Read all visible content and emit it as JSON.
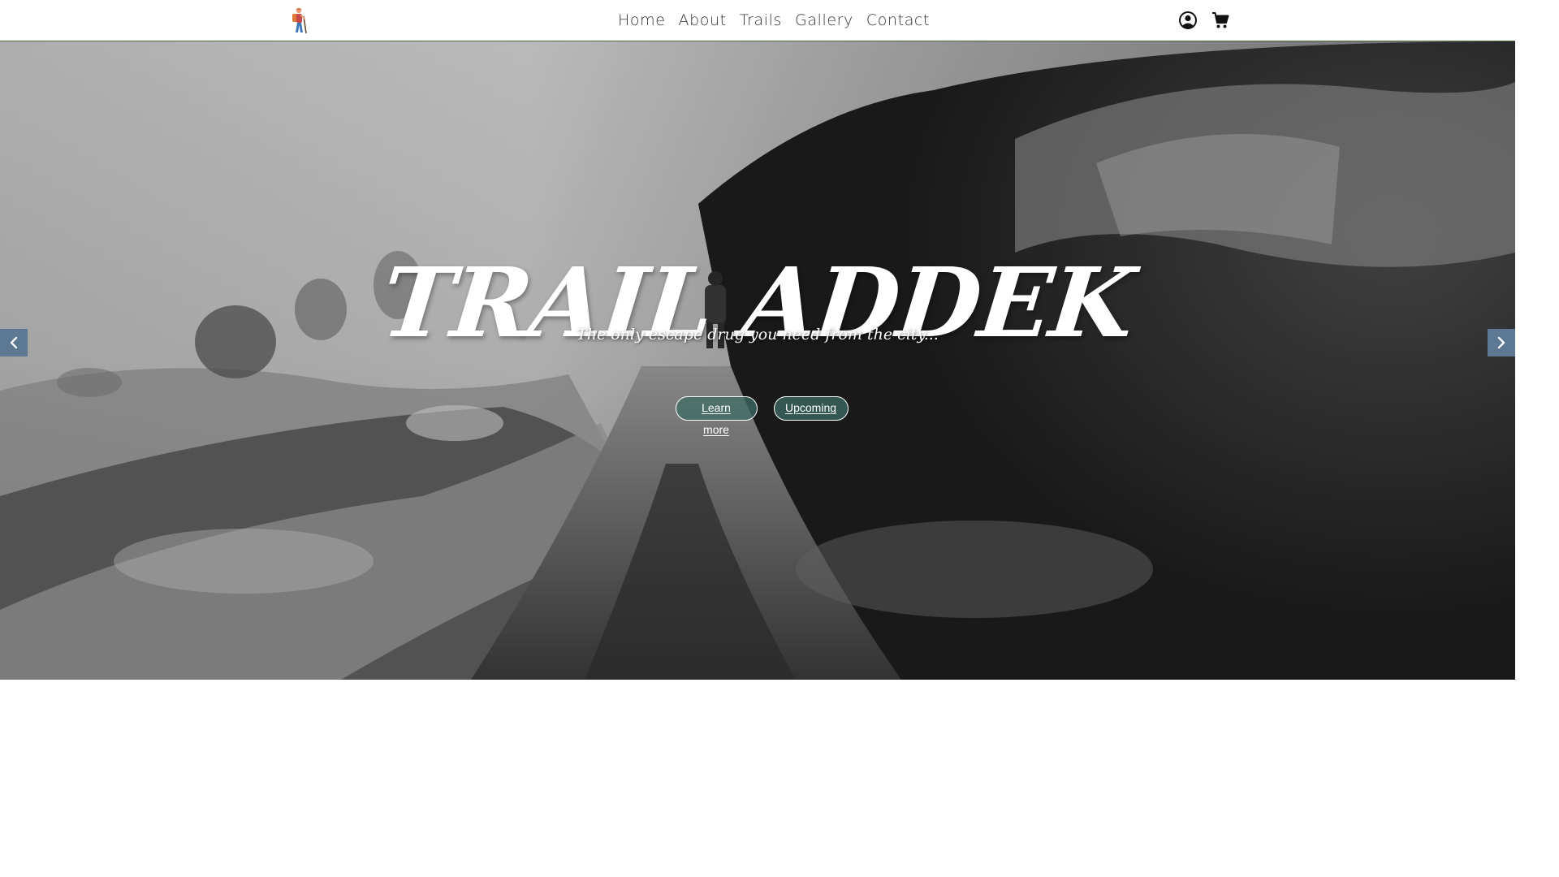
{
  "nav": {
    "logo_icon": "hiker-icon",
    "links": [
      "Home",
      "About",
      "Trails",
      "Gallery",
      "Contact"
    ],
    "icons": [
      "user-circle-icon",
      "shopping-cart-icon"
    ]
  },
  "hero": {
    "title": "TRAIL ADDEK",
    "subtitle": "The only escape drug you need from the city...",
    "buttons": {
      "learn_more": "Learn more",
      "upcoming": "Upcoming"
    },
    "arrows": [
      "chevron-left-icon",
      "chevron-right-icon"
    ]
  },
  "colors": {
    "nav_border": "#4a6b3e",
    "arrow_bg": "#5d7893",
    "button_bg": "#3e6e64"
  }
}
